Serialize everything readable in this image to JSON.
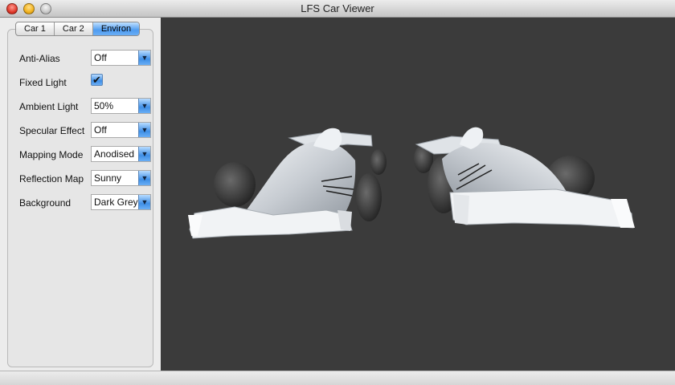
{
  "window": {
    "title": "LFS Car Viewer"
  },
  "tabs": [
    {
      "label": "Car 1",
      "active": false
    },
    {
      "label": "Car 2",
      "active": false
    },
    {
      "label": "Environ",
      "active": true
    }
  ],
  "settings": {
    "anti_alias": {
      "label": "Anti-Alias",
      "value": "Off"
    },
    "fixed_light": {
      "label": "Fixed Light",
      "checked": true
    },
    "ambient_light": {
      "label": "Ambient Light",
      "value": "50%"
    },
    "specular_effect": {
      "label": "Specular Effect",
      "value": "Off"
    },
    "mapping_mode": {
      "label": "Mapping Mode",
      "value": "Anodised"
    },
    "reflection_map": {
      "label": "Reflection Map",
      "value": "Sunny"
    },
    "background": {
      "label": "Background",
      "value": "Dark Grey"
    }
  },
  "colors": {
    "viewport_bg": "#3b3b3b",
    "accent": "#4f9cf0"
  }
}
